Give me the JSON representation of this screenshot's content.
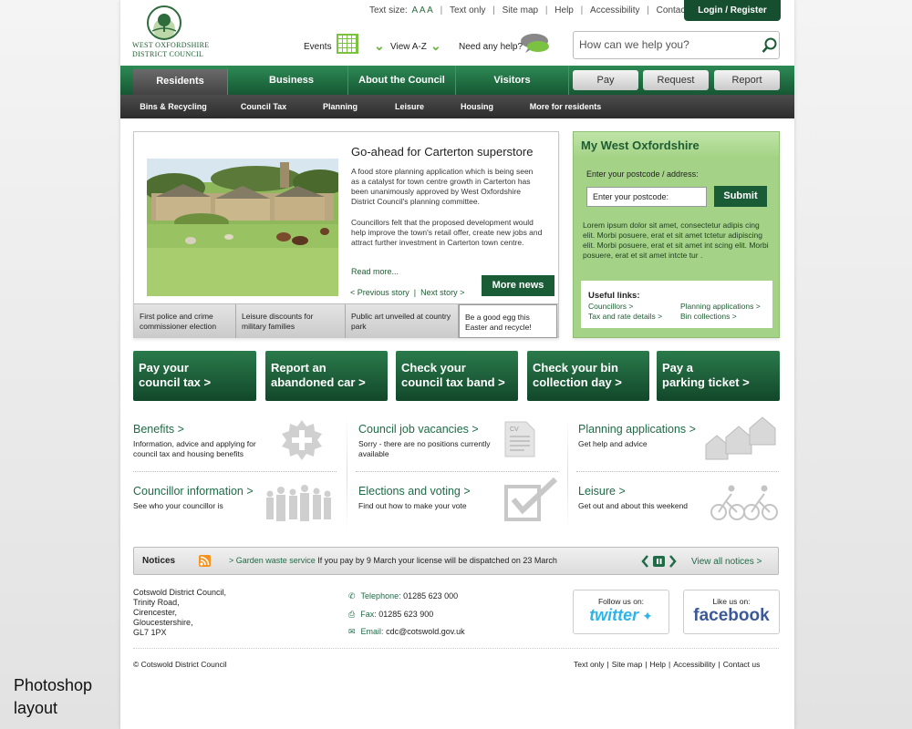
{
  "caption_line1": "Photoshop",
  "caption_line2": "layout",
  "logo": {
    "line1": "WEST OXFORDSHIRE",
    "line2": "DISTRICT COUNCIL"
  },
  "utility": {
    "text_size": "Text size:",
    "text_size_a": "A A A",
    "text_only": "Text only",
    "site_map": "Site map",
    "help": "Help",
    "accessibility": "Accessibility",
    "contact": "Contact us"
  },
  "login": "Login / Register",
  "events": "Events",
  "view_az": "View A-Z",
  "need_help": "Need any help?",
  "search": {
    "placeholder": "How can we help you?"
  },
  "main_nav": [
    "Residents",
    "Business",
    "About the Council",
    "Visitors"
  ],
  "action_buttons": [
    "Pay",
    "Request",
    "Report"
  ],
  "sub_nav": [
    "Bins & Recycling",
    "Council Tax",
    "Planning",
    "Leisure",
    "Housing",
    "More for residents"
  ],
  "feature": {
    "title": "Go-ahead for Carterton superstore",
    "body1": "A food store planning application which is being seen as a catalyst for town centre growth in Carterton has been unanimously approved by West Oxfordshire District Council's planning committee.",
    "body2": "Councillors felt that the proposed development would help improve the town's retail offer, create new jobs and attract further investment in Carterton town centre.",
    "read_more": "Read more...",
    "prev": "< Previous story",
    "next": "Next story >",
    "more_news": "More news",
    "tabs": [
      "First police and crime commissioner election",
      "Leisure discounts for military families",
      "Public art unveiled at country park",
      "Be a good egg this Easter and recycle!"
    ]
  },
  "mywo": {
    "title": "My West Oxfordshire",
    "label": "Enter your postcode / address:",
    "placeholder": "Enter your postcode:",
    "submit": "Submit",
    "lorem": "Lorem ipsum dolor sit amet, consectetur adipis cing elit. Morbi posuere, erat et sit amet tctetur adipiscing elit. Morbi posuere, erat et sit amet int scing elit. Morbi posuere, erat et sit amet intcte tur .",
    "useful_title": "Useful links:",
    "links": [
      "Councillors >",
      "Tax and rate details >",
      "Planning applications >",
      "Bin collections >"
    ]
  },
  "tiles": [
    {
      "l1": "Pay your",
      "l2": "council tax >"
    },
    {
      "l1": "Report an",
      "l2": "abandoned car >"
    },
    {
      "l1": "Check your",
      "l2": "council tax band >"
    },
    {
      "l1": "Check your bin",
      "l2": "collection day >"
    },
    {
      "l1": "Pay a",
      "l2": "parking ticket >"
    }
  ],
  "services": [
    {
      "title": "Benefits >",
      "desc": "Information, advice and applying for council tax and housing benefits"
    },
    {
      "title": "Council job vacancies >",
      "desc": "Sorry - there are no positions currently available"
    },
    {
      "title": "Planning applications >",
      "desc": "Get help and advice"
    },
    {
      "title": "Councillor information >",
      "desc": "See who your councillor is"
    },
    {
      "title": "Elections and voting >",
      "desc": "Find out how to make your vote"
    },
    {
      "title": "Leisure >",
      "desc": "Get out and about this weekend"
    }
  ],
  "notices": {
    "label": "Notices",
    "link": "> Garden waste service",
    "text": " If you pay by 9 March your license will be dispatched on 23 March",
    "view_all": "View all notices >"
  },
  "address": "Cotswold District Council,\nTrinity Road,\nCirencester,\nGloucestershire,\nGL7 1PX",
  "contacts": [
    {
      "label": "Telephone:",
      "value": " 01285 623 000"
    },
    {
      "label": "Fax:",
      "value": " 01285 623 900"
    },
    {
      "label": "Email:",
      "value": " cdc@cotswold.gov.uk"
    }
  ],
  "social": {
    "twitter_follow": "Follow us on:",
    "twitter": "twitter",
    "facebook_like": "Like us on:",
    "facebook": "facebook"
  },
  "copyright": "© Cotswold District Council",
  "footer_links": [
    "Text only",
    "Site map",
    "Help",
    "Accessibility",
    "Contact us"
  ],
  "colors": {
    "brand_green": "#1a5c36",
    "accent_green": "#6cb33f",
    "panel_green": "#a4d387"
  }
}
